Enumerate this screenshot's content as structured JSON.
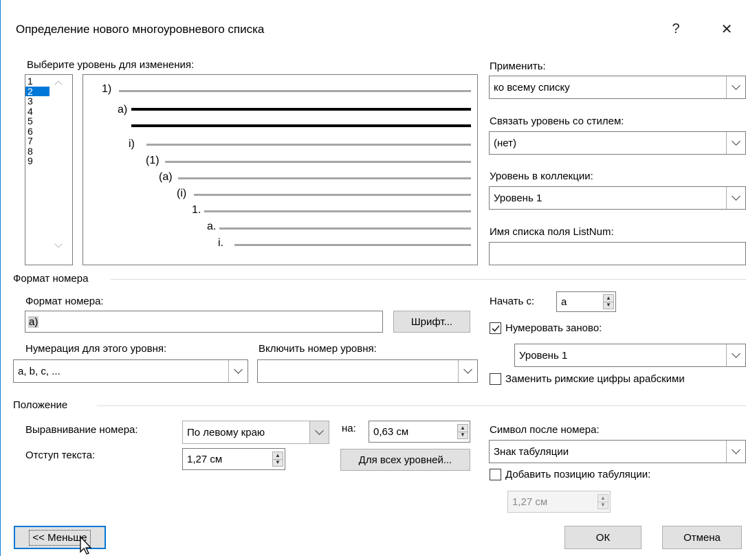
{
  "dialog": {
    "title": "Определение нового многоуровневого списка",
    "help_label": "?",
    "close_label": "✕"
  },
  "levels": {
    "label": "Выберите уровень для изменения:",
    "items": [
      "1",
      "2",
      "3",
      "4",
      "5",
      "6",
      "7",
      "8",
      "9"
    ],
    "selected": "2"
  },
  "preview": {
    "numbers": [
      "1)",
      "a)",
      "",
      "i)",
      "(1)",
      "(a)",
      "(i)",
      "1.",
      "a.",
      "i."
    ]
  },
  "right": {
    "apply_label": "Применить:",
    "apply_value": "ко всему списку",
    "link_style_label": "Связать уровень со стилем:",
    "link_style_value": "(нет)",
    "gallery_level_label": "Уровень в коллекции:",
    "gallery_level_value": "Уровень 1",
    "listnum_label": "Имя списка поля ListNum:",
    "listnum_value": ""
  },
  "number_format": {
    "section_title": "Формат номера",
    "format_label": "Формат номера:",
    "format_value": "a)",
    "font_button": "Шрифт...",
    "numbering_style_label": "Нумерация для этого уровня:",
    "numbering_style_value": "a, b, c, ...",
    "include_level_label": "Включить номер уровня:",
    "include_level_value": "",
    "start_at_label": "Начать с:",
    "start_at_value": "a",
    "restart_label": "Нумеровать заново:",
    "restart_checked": true,
    "restart_after_value": "Уровень 1",
    "legal_label": "Заменить римские цифры арабскими",
    "legal_checked": false
  },
  "position": {
    "section_title": "Положение",
    "alignment_label": "Выравнивание номера:",
    "alignment_value": "По левому краю",
    "at_label": "на:",
    "at_value": "0,63 см",
    "indent_label": "Отступ текста:",
    "indent_value": "1,27 см",
    "all_levels_button": "Для всех уровней...",
    "follow_label": "Символ после номера:",
    "follow_value": "Знак табуляции",
    "add_tab_label": "Добавить позицию табуляции:",
    "add_tab_checked": false,
    "tab_value": "1,27 см"
  },
  "footer": {
    "less_button": "<< Меньше",
    "ok_button": "ОК",
    "cancel_button": "Отмена"
  },
  "colors": {
    "accent": "#0078d7",
    "window_border": "#1883d7"
  }
}
